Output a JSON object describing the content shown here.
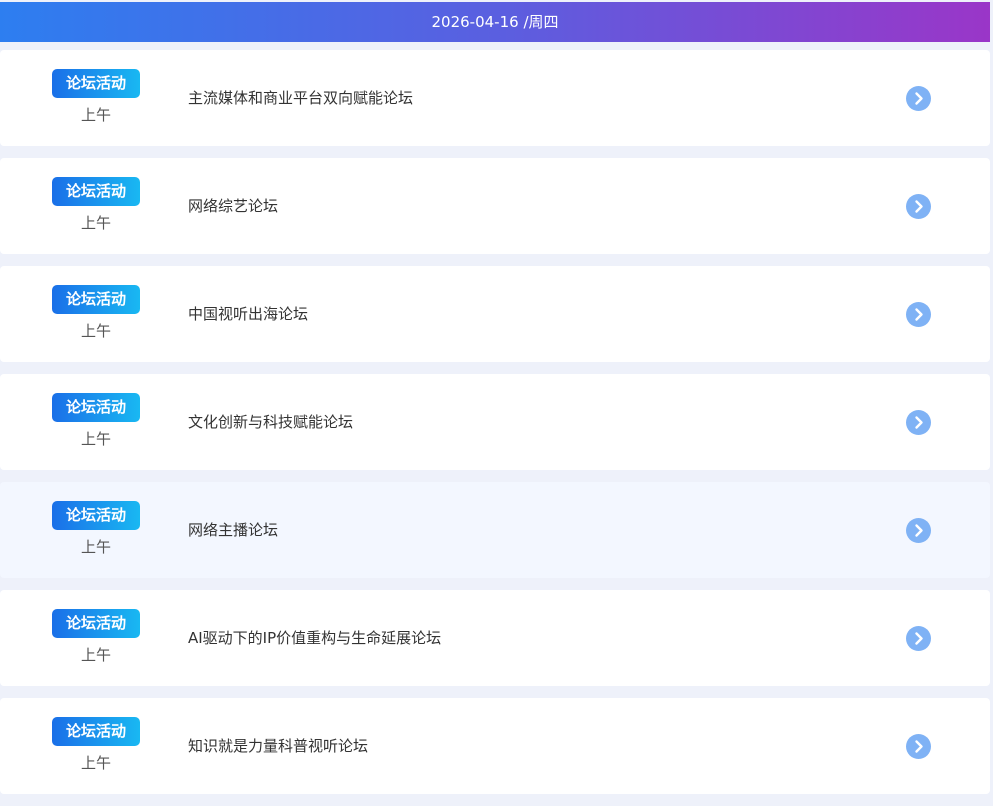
{
  "header": {
    "date": "2026-04-16 /周四"
  },
  "events": [
    {
      "badge": "论坛活动",
      "period": "上午",
      "title": "主流媒体和商业平台双向赋能论坛"
    },
    {
      "badge": "论坛活动",
      "period": "上午",
      "title": "网络综艺论坛"
    },
    {
      "badge": "论坛活动",
      "period": "上午",
      "title": "中国视听出海论坛"
    },
    {
      "badge": "论坛活动",
      "period": "上午",
      "title": "文化创新与科技赋能论坛"
    },
    {
      "badge": "论坛活动",
      "period": "上午",
      "title": "网络主播论坛"
    },
    {
      "badge": "论坛活动",
      "period": "上午",
      "title": "AI驱动下的IP价值重构与生命延展论坛"
    },
    {
      "badge": "论坛活动",
      "period": "上午",
      "title": "知识就是力量科普视听论坛"
    }
  ],
  "icons": {
    "row_action": "chevron-right-icon"
  },
  "colors": {
    "header_gradient_start": "#2d7ef0",
    "header_gradient_end": "#9a36c8",
    "badge_gradient_start": "#1a6fe8",
    "badge_gradient_end": "#19b8f2",
    "arrow_circle": "#7fb2f5",
    "page_background": "#eef1fa",
    "highlighted_row": "#f3f7ff"
  }
}
